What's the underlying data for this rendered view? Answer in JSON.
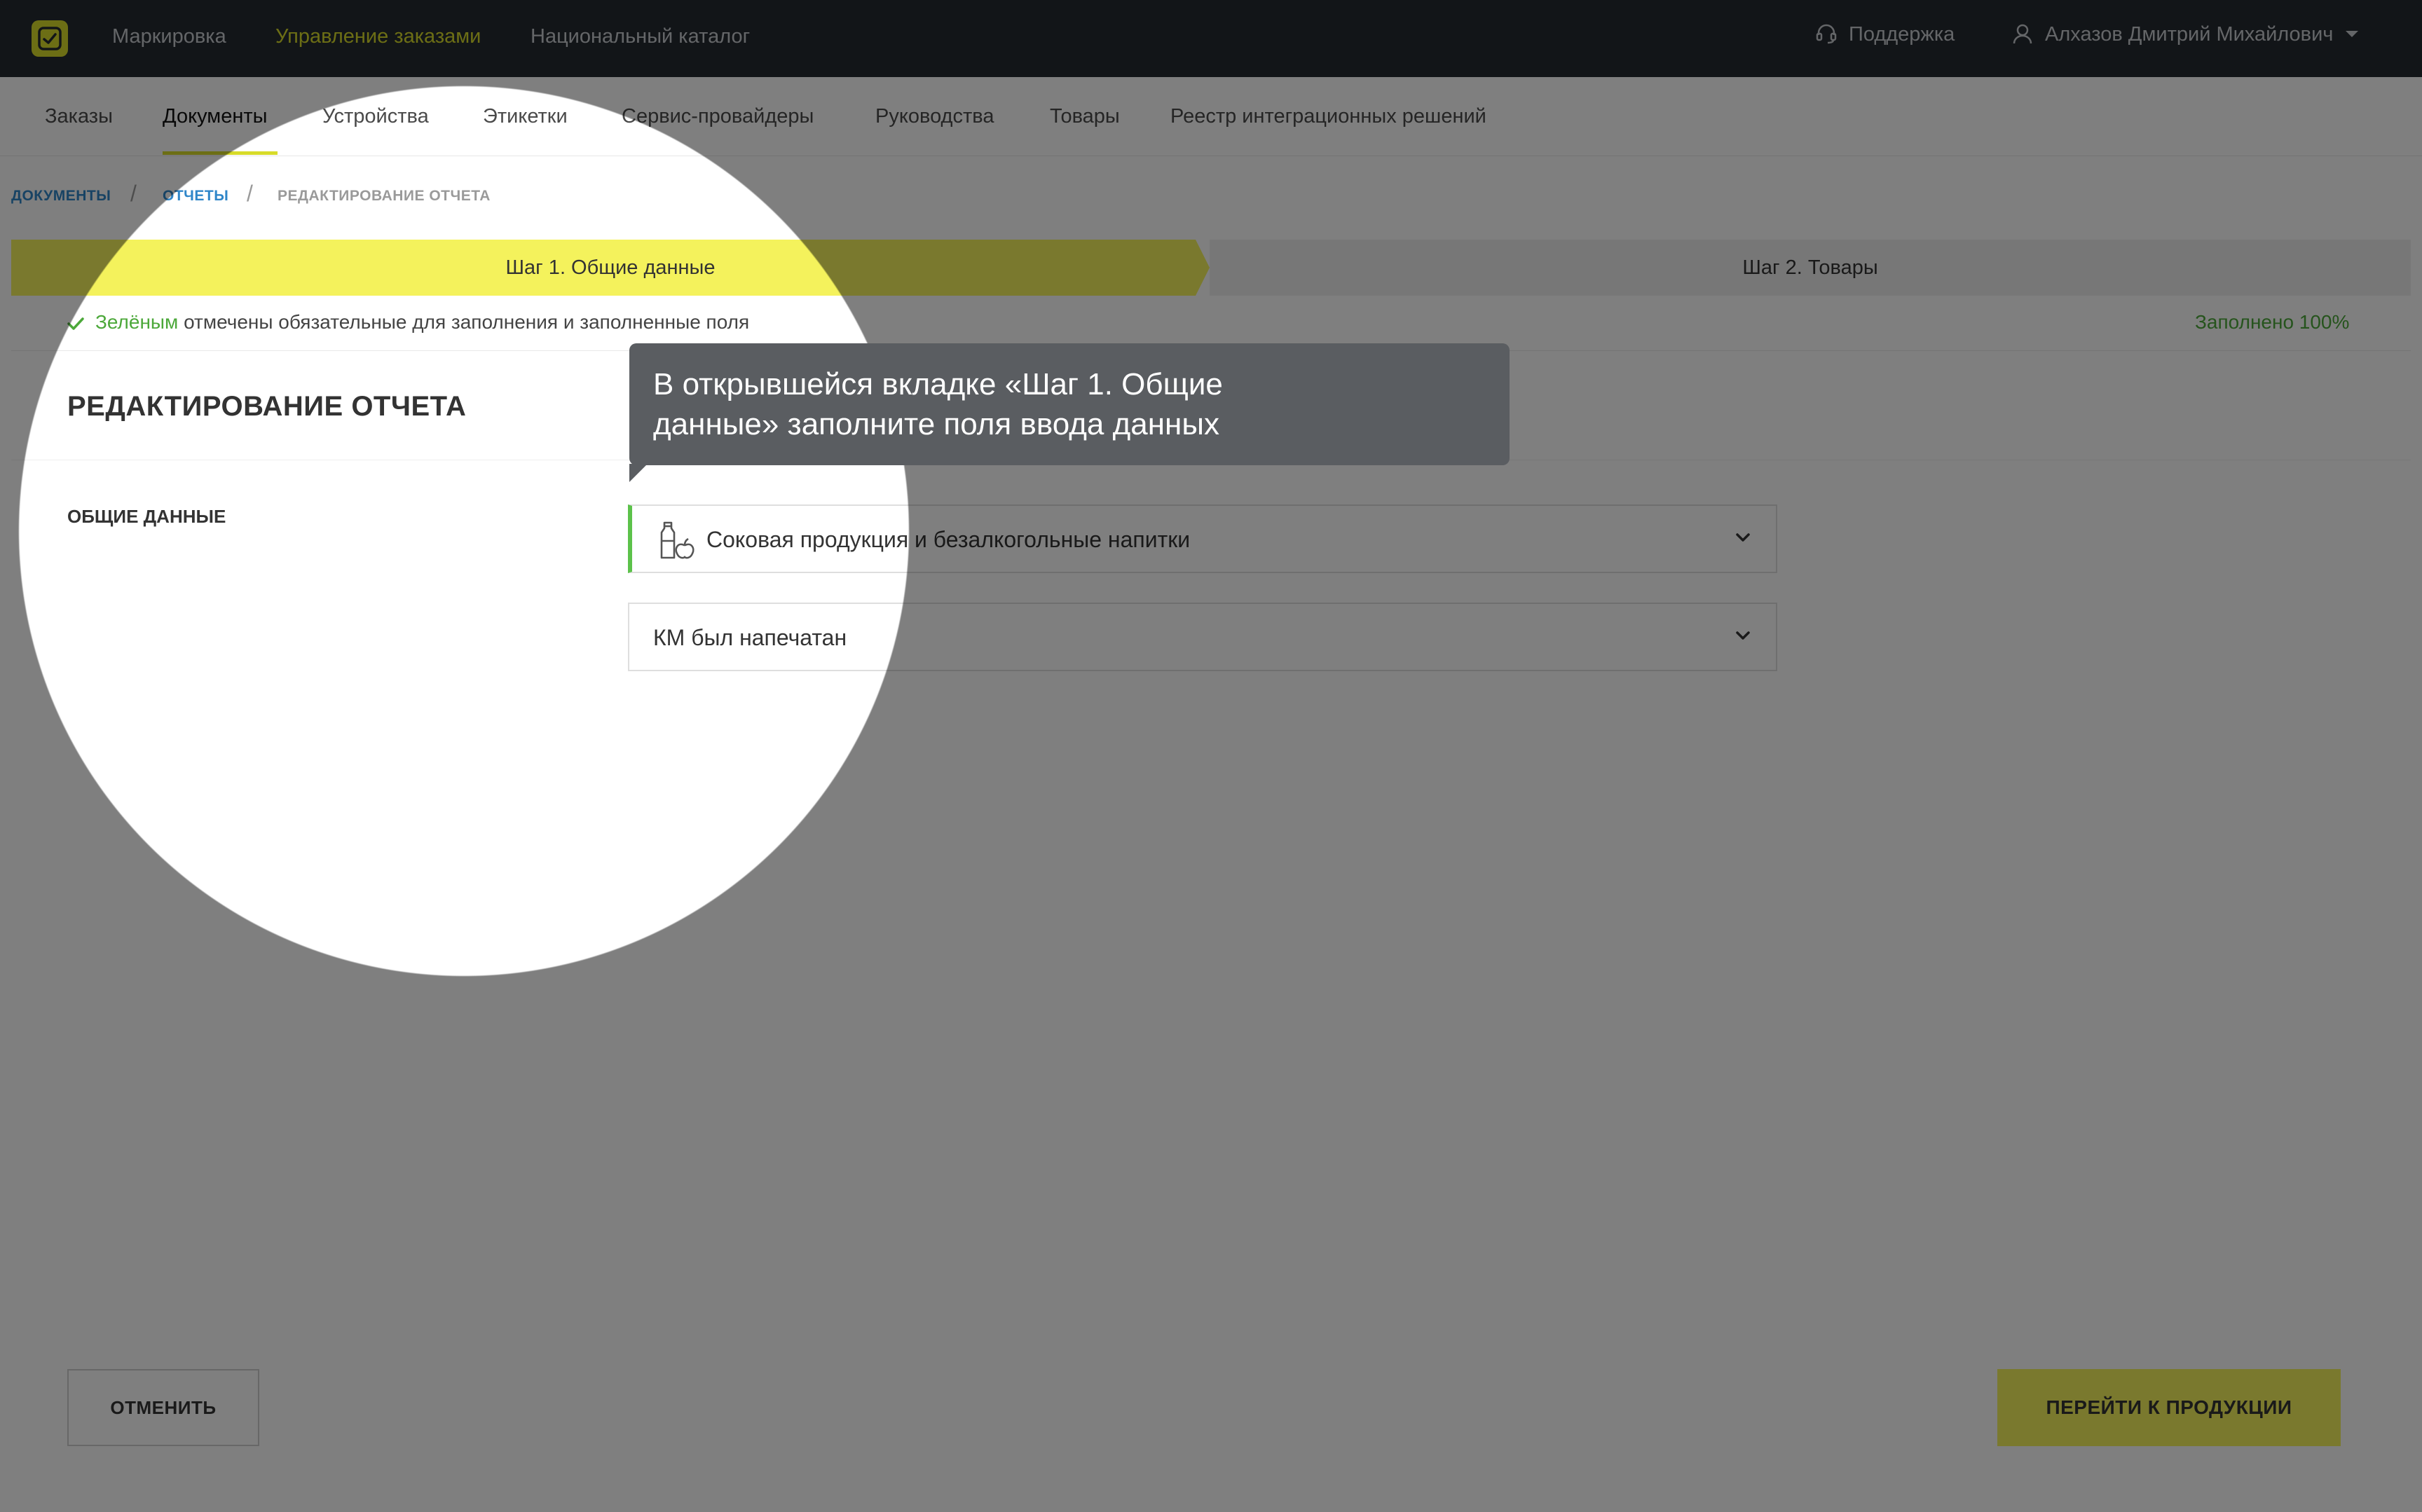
{
  "topbar": {
    "nav": [
      "Маркировка",
      "Управление заказами",
      "Национальный каталог"
    ],
    "active_index": 1,
    "support_label": "Поддержка",
    "user_name": "Алхазов Дмитрий Михайлович"
  },
  "subnav": {
    "items": [
      "Заказы",
      "Документы",
      "Устройства",
      "Этикетки",
      "Сервис-провайдеры",
      "Руководства",
      "Товары",
      "Реестр интеграционных решений"
    ],
    "active_index": 1
  },
  "breadcrumb": {
    "items": [
      "ДОКУМЕНТЫ",
      "ОТЧЕТЫ",
      "РЕДАКТИРОВАНИЕ ОТЧЕТА"
    ],
    "separator": "/"
  },
  "stepper": {
    "step1": "Шаг 1. Общие данные",
    "step2": "Шаг 2. Товары"
  },
  "hint": {
    "green_word": "Зелёным",
    "rest": " отмечены обязательные для заполнения и заполненные поля",
    "filled": "Заполнено 100%"
  },
  "form": {
    "title": "РЕДАКТИРОВАНИЕ ОТЧЕТА",
    "section_label": "ОБЩИЕ ДАННЫЕ",
    "product_group": "Соковая продукция и безалкогольные напитки",
    "km_status": "КМ был напечатан"
  },
  "buttons": {
    "cancel": "ОТМЕНИТЬ",
    "next": "ПЕРЕЙТИ К ПРОДУКЦИИ"
  },
  "tooltip": {
    "line1": "В открывшейся вкладке «Шаг 1. Общие",
    "line2": "данные» заполните поля ввода данных"
  },
  "colors": {
    "accent_yellow": "#f4f25c",
    "topbar_bg": "#252a31",
    "link_blue": "#2f86c9",
    "success_green": "#4ca83a",
    "tooltip_bg": "#5a5d61"
  }
}
